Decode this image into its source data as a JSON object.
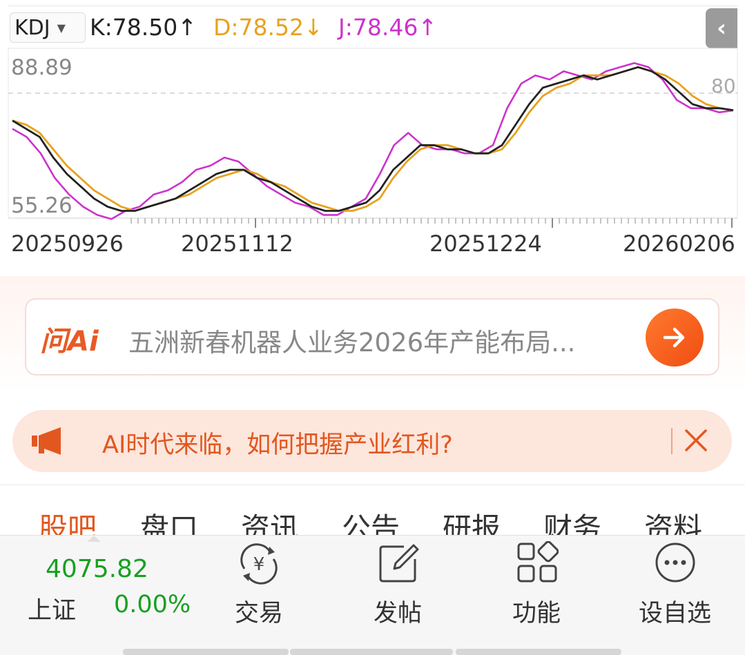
{
  "chart_data": {
    "type": "line",
    "indicator": "KDJ",
    "title": "",
    "x_ticks": [
      "20250926",
      "20251112",
      "20251224",
      "20260206"
    ],
    "ylim": [
      55.26,
      88.89
    ],
    "reference_line": 80,
    "grid": false,
    "colors": {
      "K": "#222222",
      "D": "#e8a21e",
      "J": "#cc33cc"
    },
    "series": [
      {
        "name": "K",
        "values": [
          76,
          74,
          72,
          67,
          63,
          60,
          57,
          55,
          54,
          54,
          55,
          56,
          57,
          59,
          61,
          63,
          64,
          64,
          62,
          61,
          59,
          57,
          55,
          54,
          54,
          55,
          56,
          59,
          64,
          67,
          70,
          70,
          69,
          69,
          68,
          68,
          70,
          75,
          80,
          84,
          85,
          86,
          87,
          86,
          87,
          88,
          89,
          88,
          86,
          83,
          80,
          79,
          79,
          78.5
        ]
      },
      {
        "name": "D",
        "values": [
          76,
          75,
          73,
          69,
          65,
          62,
          59,
          57,
          55,
          54,
          55,
          56,
          57,
          58,
          60,
          62,
          63,
          64,
          63,
          61,
          60,
          58,
          56,
          55,
          54,
          54,
          55,
          57,
          62,
          66,
          69,
          70,
          70,
          69,
          68,
          68,
          69,
          73,
          78,
          82,
          84,
          85,
          87,
          87,
          87,
          88,
          89,
          88,
          87,
          85,
          82,
          80,
          79,
          78.52
        ]
      },
      {
        "name": "J",
        "values": [
          74,
          72,
          68,
          62,
          58,
          55,
          53,
          52,
          54,
          55,
          58,
          59,
          61,
          64,
          65,
          67,
          66,
          63,
          60,
          58,
          56,
          55,
          53,
          53,
          55,
          57,
          63,
          70,
          73,
          70,
          69,
          69,
          68,
          68,
          70,
          79,
          85,
          87,
          86,
          88,
          87,
          86,
          88,
          89,
          90,
          89,
          86,
          81,
          79,
          79,
          78,
          78.46
        ]
      }
    ]
  },
  "header": {
    "indicator_select": "KDJ",
    "k_label": "K:78.50",
    "k_arrow": "↑",
    "d_label": "D:78.52",
    "d_arrow": "↓",
    "j_label": "J:78.46",
    "j_arrow": "↑",
    "collapse_icon": "chevron-left-icon",
    "y_high": "88.89",
    "y_low": "55.26",
    "ref_label": "80"
  },
  "ai_search": {
    "logo": "问Ai",
    "query": "五洲新春机器人业务2026年产能布局...",
    "go_icon": "arrow-right-icon"
  },
  "banner": {
    "icon": "megaphone-icon",
    "text": "AI时代来临，如何把握产业红利?",
    "close_icon": "close-icon"
  },
  "tabs": [
    "股吧",
    "盘口",
    "资讯",
    "公告",
    "研报",
    "财务",
    "资料"
  ],
  "active_tab": "股吧",
  "bottom_bar": {
    "index_value": "4075.82",
    "index_name": "上证",
    "index_change": "0.00%",
    "trade": "交易",
    "post": "发帖",
    "functions": "功能",
    "watchlist": "设自选"
  }
}
